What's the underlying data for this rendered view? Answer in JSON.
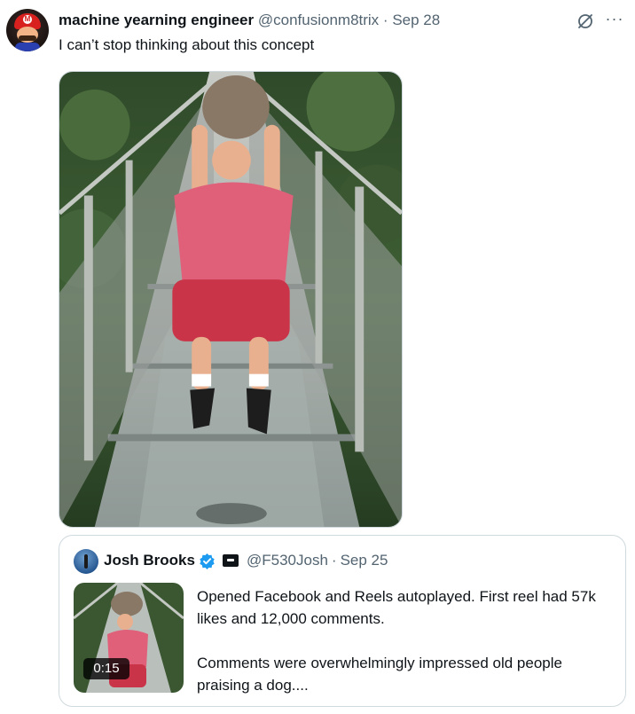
{
  "tweet": {
    "author_name": "machine yearning engineer",
    "author_handle": "@confusionm8trix",
    "separator": "·",
    "date": "Sep 28",
    "text": "I can’t stop thinking about this concept",
    "avatar_icon": "mario-avatar",
    "actions": [
      "grok-icon",
      "more-icon"
    ],
    "more_label": "···"
  },
  "quote": {
    "author_name": "Josh Brooks",
    "verified": true,
    "affiliation_icon": "affiliate-badge-icon",
    "author_handle": "@F530Josh",
    "separator": "·",
    "date": "Sep 25",
    "paragraphs": [
      "Opened Facebook and Reels autoplayed. First reel had 57k likes and 12,000 comments.",
      "Comments were overwhelmingly impressed old people praising a dog...."
    ],
    "video_duration": "0:15"
  },
  "colors": {
    "text_primary": "#0f1419",
    "text_secondary": "#536471",
    "border": "#cfd9de",
    "verified_blue": "#1d9bf0"
  }
}
